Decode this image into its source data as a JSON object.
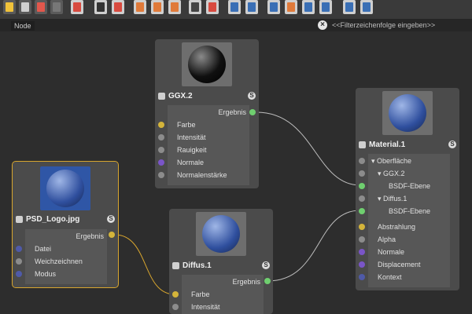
{
  "address_bar": {
    "breadcrumb": "Node",
    "filter_placeholder": "<<Filterzeichenfolge eingeben>>",
    "clear_icon": "close-icon"
  },
  "toolbar": {
    "icons": [
      "add-node-icon",
      "select-icon",
      "frame-icon",
      "disabled-icon",
      "back-icon",
      "solo-icon",
      "reload-icon",
      "layout-1-icon",
      "layout-2-icon",
      "layout-3-icon",
      "play-icon",
      "play-alt-icon",
      "tree-icon",
      "connect-icon",
      "magic-icon",
      "preview-icon",
      "brush-icon",
      "arrange-icon",
      "arrange-alt-icon"
    ]
  },
  "nodes": {
    "ggx": {
      "title": "GGX.2",
      "badge": "S",
      "output": "Ergebnis",
      "inputs": [
        "Farbe",
        "Intensität",
        "Rauigkeit",
        "Normale",
        "Normalenstärke"
      ]
    },
    "psd": {
      "title": "PSD_Logo.jpg",
      "badge": "S",
      "output": "Ergebnis",
      "inputs": [
        "Datei",
        "Weichzeichnen",
        "Modus"
      ]
    },
    "diffus": {
      "title": "Diffus.1",
      "badge": "S",
      "output": "Ergebnis",
      "inputs": [
        "Farbe",
        "Intensität"
      ]
    },
    "material": {
      "title": "Material.1",
      "badge": "S",
      "inputs": [
        "Oberfläche",
        "GGX.2",
        "BSDF-Ebene",
        "Diffus.1",
        "BSDF-Ebene",
        "Abstrahlung",
        "Alpha",
        "Normale",
        "Displacement",
        "Kontext"
      ]
    }
  },
  "colors": {
    "selection": "#d7a52e",
    "output_port": "#6fcf6f",
    "color_port": "#d4b43a",
    "wire": "#bfbfbf",
    "wire_selected": "#d7a52e"
  }
}
